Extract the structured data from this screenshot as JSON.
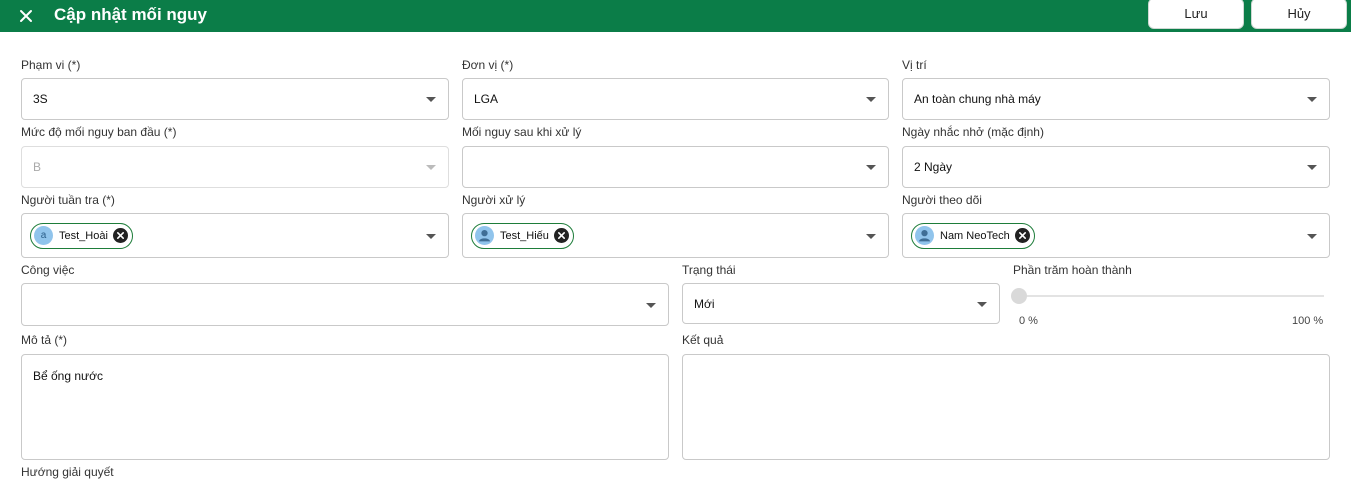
{
  "header": {
    "title": "Cập nhật mối nguy",
    "save_label": "Lưu",
    "cancel_label": "Hủy",
    "close_icon": "close-icon"
  },
  "form": {
    "scope": {
      "label": "Phạm vi (*)",
      "value": "3S"
    },
    "unit": {
      "label": "Đơn vị (*)",
      "value": "LGA"
    },
    "location": {
      "label": "Vị trí",
      "value": "An toàn chung nhà máy"
    },
    "initial_level": {
      "label": "Mức độ mối nguy ban đầu (*)",
      "value": "B"
    },
    "after_level": {
      "label": "Mối nguy sau khi xử lý",
      "value": ""
    },
    "reminder": {
      "label": "Ngày nhắc nhở (mặc định)",
      "value": "2 Ngày"
    },
    "inspector": {
      "label": "Người tuần tra (*)",
      "chip": "Test_Hoài",
      "avatar_letter": "a"
    },
    "handler": {
      "label": "Người xử lý",
      "chip": "Test_Hiếu"
    },
    "follower": {
      "label": "Người theo dõi",
      "chip": "Nam NeoTech"
    },
    "task": {
      "label": "Công việc",
      "value": ""
    },
    "status": {
      "label": "Trạng thái",
      "value": "Mới"
    },
    "progress": {
      "label": "Phần trăm hoàn thành",
      "value": 0,
      "min_label": "0 %",
      "max_label": "100 %"
    },
    "description": {
      "label": "Mô tả (*)",
      "value": "Bể ống nước"
    },
    "result": {
      "label": "Kết quả",
      "value": ""
    },
    "solution": {
      "label": "Hướng giải quyết"
    }
  }
}
